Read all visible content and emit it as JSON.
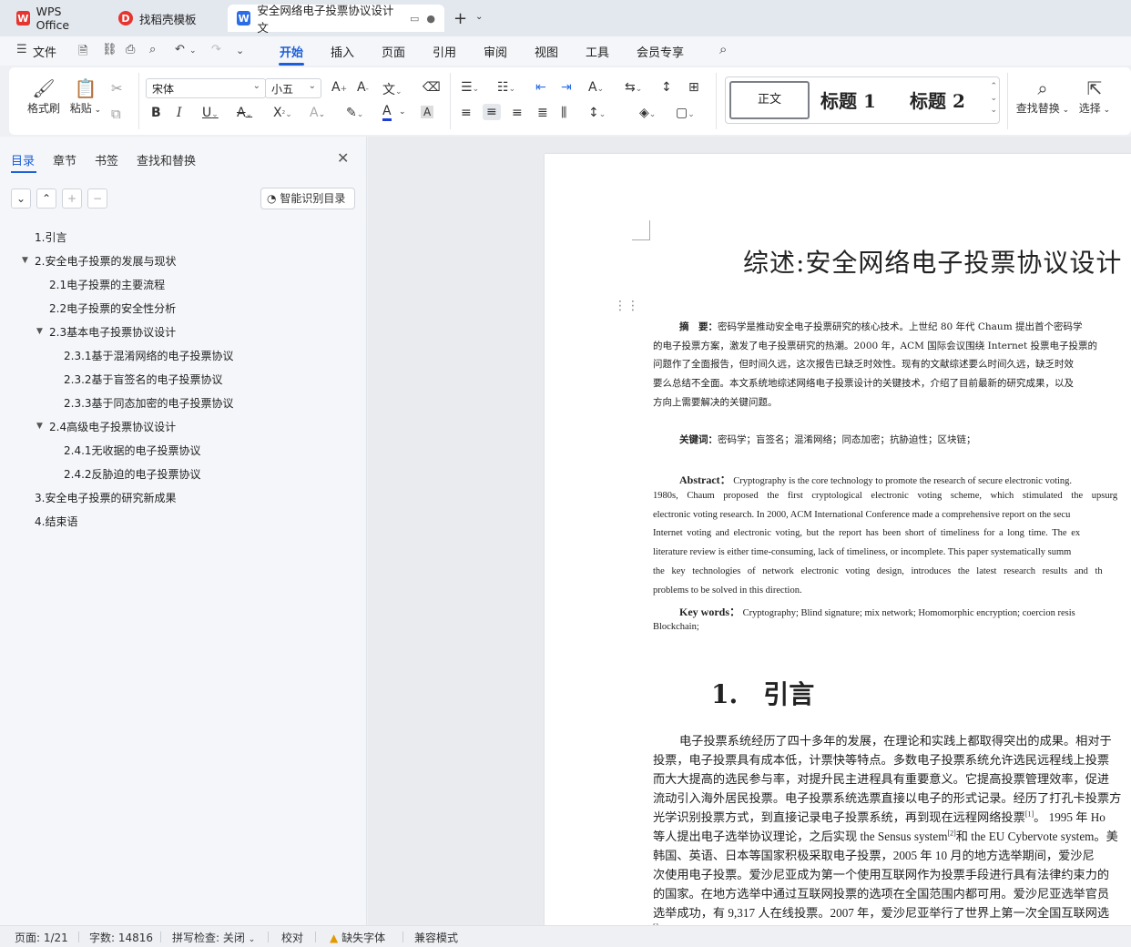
{
  "tabs": [
    {
      "label": "WPS Office",
      "logo": "W",
      "logo_color": "#e6352f"
    },
    {
      "label": "找稻壳模板",
      "logo": "D",
      "logo_color": "#e6352f"
    },
    {
      "label": "安全网络电子投票协议设计 文",
      "logo": "W",
      "logo_color": "#2b6de8"
    }
  ],
  "menubar": {
    "file": "文件",
    "items": [
      "开始",
      "插入",
      "页面",
      "引用",
      "审阅",
      "视图",
      "工具",
      "会员专享"
    ],
    "active": "开始"
  },
  "ribbon": {
    "format_painter": "格式刷",
    "paste": "粘贴",
    "font_name": "宋体",
    "font_size": "小五",
    "styles": {
      "normal": "正文",
      "h1": "标题 1",
      "h2": "标题 2"
    },
    "find_replace": "查找替换",
    "select": "选择"
  },
  "leftpanel": {
    "tabs": [
      "目录",
      "章节",
      "书签",
      "查找和替换"
    ],
    "smart_toc": "智能识别目录",
    "toc": [
      {
        "label": "1.引言",
        "level": 1,
        "expanded": null
      },
      {
        "label": "2.安全电子投票的发展与现状",
        "level": 1,
        "expanded": true
      },
      {
        "label": "2.1电子投票的主要流程",
        "level": 2,
        "expanded": null
      },
      {
        "label": "2.2电子投票的安全性分析",
        "level": 2,
        "expanded": null
      },
      {
        "label": "2.3基本电子投票协议设计",
        "level": 2,
        "expanded": true
      },
      {
        "label": "2.3.1基于混淆网络的电子投票协议",
        "level": 3,
        "expanded": null
      },
      {
        "label": "2.3.2基于盲签名的电子投票协议",
        "level": 3,
        "expanded": null
      },
      {
        "label": "2.3.3基于同态加密的电子投票协议",
        "level": 3,
        "expanded": null
      },
      {
        "label": "2.4高级电子投票协议设计",
        "level": 2,
        "expanded": true
      },
      {
        "label": "2.4.1无收据的电子投票协议",
        "level": 3,
        "expanded": null
      },
      {
        "label": "2.4.2反胁迫的电子投票协议",
        "level": 3,
        "expanded": null
      },
      {
        "label": "3.安全电子投票的研究新成果",
        "level": 1,
        "expanded": null
      },
      {
        "label": "4.结束语",
        "level": 1,
        "expanded": null
      }
    ]
  },
  "document": {
    "title": "综述:安全网络电子投票协议设计",
    "abstract_cn_label": "摘　要：",
    "abstract_cn": [
      "密码学是推动安全电子投票研究的核心技术。上世纪 80 年代 Chaum 提出首个密码学",
      "的电子投票方案，激发了电子投票研究的热潮。2000 年，ACM 国际会议围绕 Internet 投票电子投票的",
      "问题作了全面报告，但时间久远，这次报告已缺乏时效性。现有的文献综述要么时间久远，缺乏时效",
      "要么总结不全面。本文系统地综述网络电子投票设计的关键技术，介绍了目前最新的研究成果，以及",
      "方向上需要解决的关键问题。"
    ],
    "keywords_cn_label": "关键词：",
    "keywords_cn": "密码学；盲签名；混淆网络；同态加密；抗胁迫性；区块链；",
    "abstract_en_label": "Abstract：",
    "abstract_en": [
      "Cryptography is the core technology to promote the research of secure electronic voting.",
      "1980s, Chaum proposed the first cryptological electronic voting scheme, which stimulated the upsurg",
      "electronic voting research. In 2000, ACM International Conference made a comprehensive report on the secu",
      "Internet voting and electronic voting, but the report has been short of timeliness for a long time. The ex",
      "literature review is either time-consuming, lack of timeliness, or incomplete. This paper systematically summ",
      "the key technologies of network electronic voting design, introduces the latest research results and th",
      "problems to be solved in this direction."
    ],
    "keywords_en_label": "Key words：",
    "keywords_en": [
      "Cryptography; Blind signature; mix network; Homomorphic encryption; coercion resis",
      "Blockchain;"
    ],
    "heading1": "1.　引言",
    "body": [
      "电子投票系统经历了四十多年的发展，在理论和实践上都取得突出的成果。相对于",
      "投票，电子投票具有成本低，计票快等特点。多数电子投票系统允许选民远程线上投票",
      "而大大提高的选民参与率，对提升民主进程具有重要意义。它提高投票管理效率，促进",
      "流动引入海外居民投票。电子投票系统选票直接以电子的形式记录。经历了打孔卡投票方",
      "光学识别投票方式，到直接记录电子投票系统，再到现在远程网络投票",
      "等人提出电子选举协议理论，之后实现 the Sensus system",
      "韩国、英语、日本等国家积极采取电子投票，2005 年 10 月的地方选举期间，爱沙尼",
      "次使用电子投票。爱沙尼亚成为第一个使用互联网作为投票手段进行具有法律约束力的",
      "的国家。在地方选举中通过互联网投票的选项在全国范围内都可用。爱沙尼亚选举官员",
      "选举成功，有 9,317 人在线投票。2007 年，爱沙尼亚举行了世界上第一次全国互联网选",
      "[]"
    ],
    "ref1": "[1]",
    "after_ref1": "。 1995 年 Ho",
    "ref2": "[2]",
    "after_ref2": "和 the EU Cybervote system。美"
  },
  "statusbar": {
    "page": "页面: 1/21",
    "words": "字数: 14816",
    "spell": "拼写检查: 关闭",
    "proof": "校对",
    "missing_font": "缺失字体",
    "compat": "兼容模式"
  }
}
